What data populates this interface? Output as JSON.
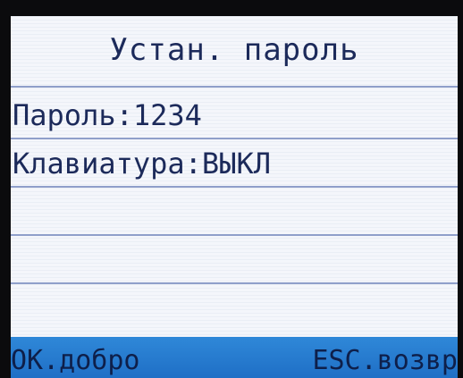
{
  "screen": {
    "title": "Устан. пароль",
    "rows": [
      {
        "label": "Пароль:1234"
      },
      {
        "label": "Клавиатура:ВЫКЛ"
      },
      {
        "label": ""
      },
      {
        "label": ""
      }
    ]
  },
  "footer": {
    "ok_label": "OK.добро",
    "esc_label": "ESC.возвр"
  },
  "colors": {
    "text": "#1c2a5a",
    "background": "#f4f6fb",
    "divider": "#8f9fca",
    "footer": "#2f88d8"
  }
}
